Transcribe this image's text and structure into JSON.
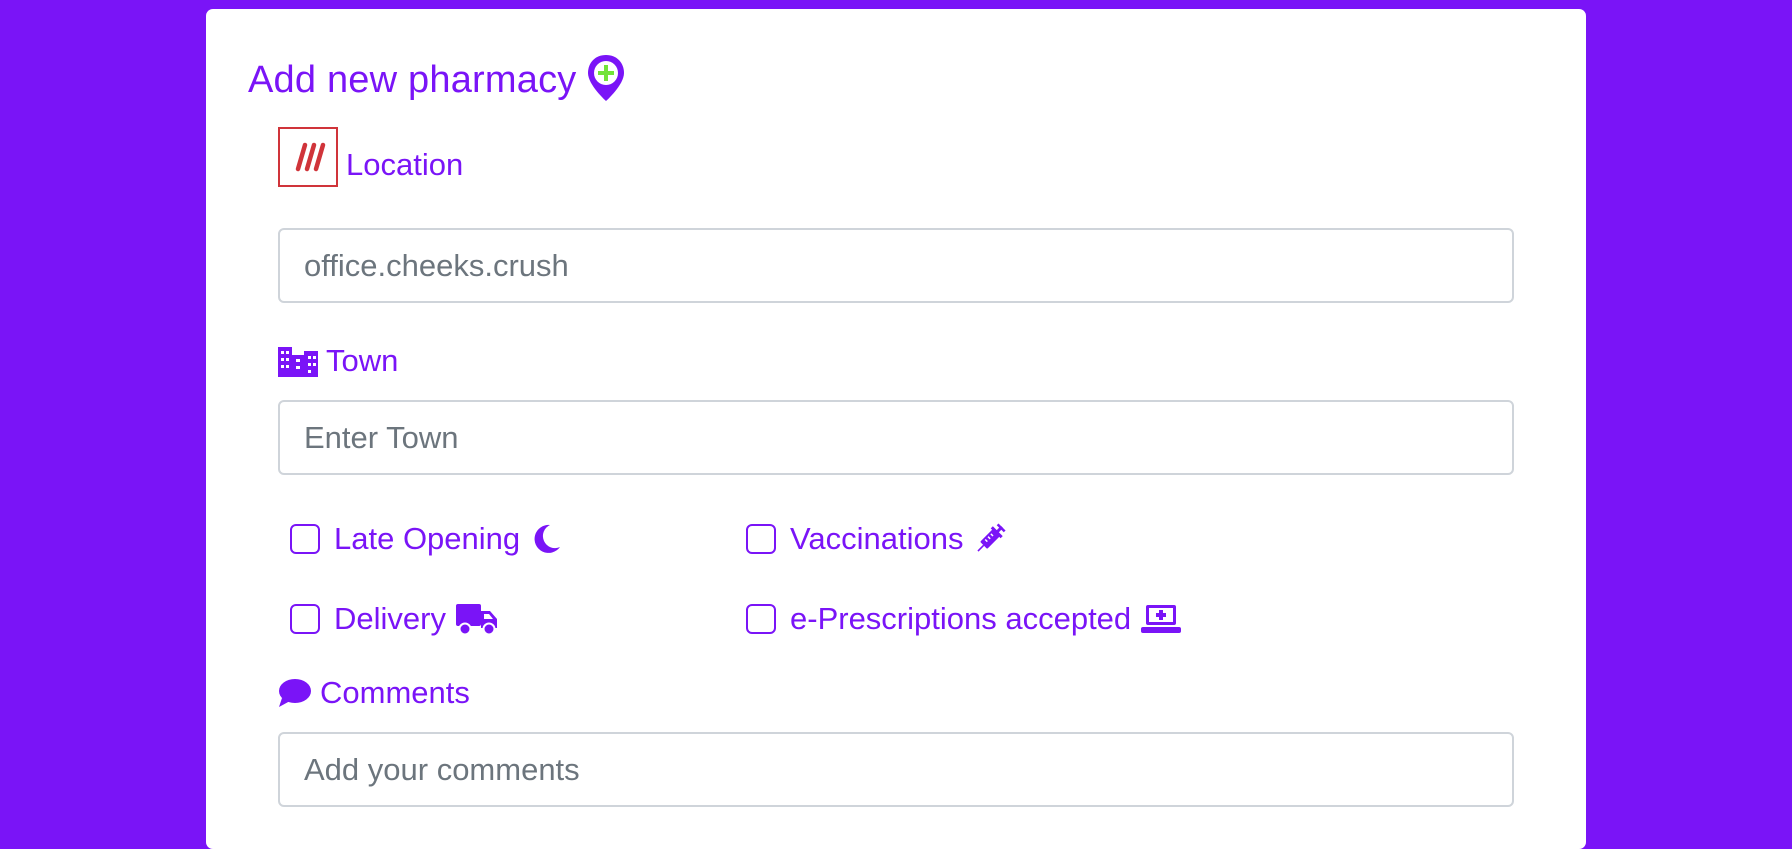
{
  "form": {
    "title": "Add new pharmacy",
    "location": {
      "label": "Location",
      "value": "office.cheeks.crush"
    },
    "town": {
      "label": "Town",
      "placeholder": "Enter Town"
    },
    "options": {
      "late_opening": {
        "label": "Late Opening",
        "checked": false
      },
      "vaccinations": {
        "label": "Vaccinations",
        "checked": false
      },
      "delivery": {
        "label": "Delivery",
        "checked": false
      },
      "e_prescriptions": {
        "label": "e-Prescriptions accepted",
        "checked": false
      }
    },
    "comments": {
      "label": "Comments",
      "placeholder": "Add your comments"
    }
  },
  "icons": {
    "title": "map-marker-plus-icon",
    "location": "what3words-icon",
    "town": "city-icon",
    "late_opening": "moon-icon",
    "vaccinations": "syringe-icon",
    "delivery": "truck-icon",
    "e_prescriptions": "laptop-medical-icon",
    "comments": "comment-icon"
  },
  "colors": {
    "background": "#7a14f7",
    "accent": "#7a14f7",
    "card": "#ffffff",
    "w3w_red": "#e11f26",
    "pin_plus": "#72e339"
  }
}
